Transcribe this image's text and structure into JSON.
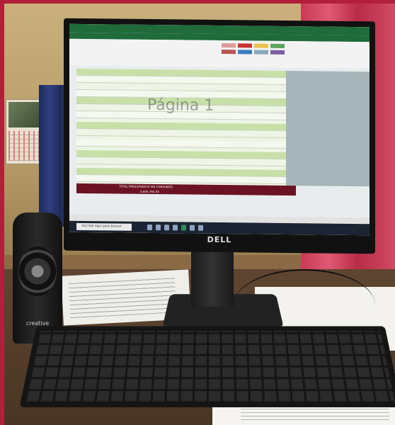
{
  "screen": {
    "watermark_text": "Página 1",
    "search_placeholder": "Escribe aquí para buscar",
    "total_label": "TOTAL PRESUPUESTO SIN CONSUMOS",
    "total_value": "2,605,794.33",
    "monitor_brand": "DELL",
    "speaker_brand": "creative"
  }
}
